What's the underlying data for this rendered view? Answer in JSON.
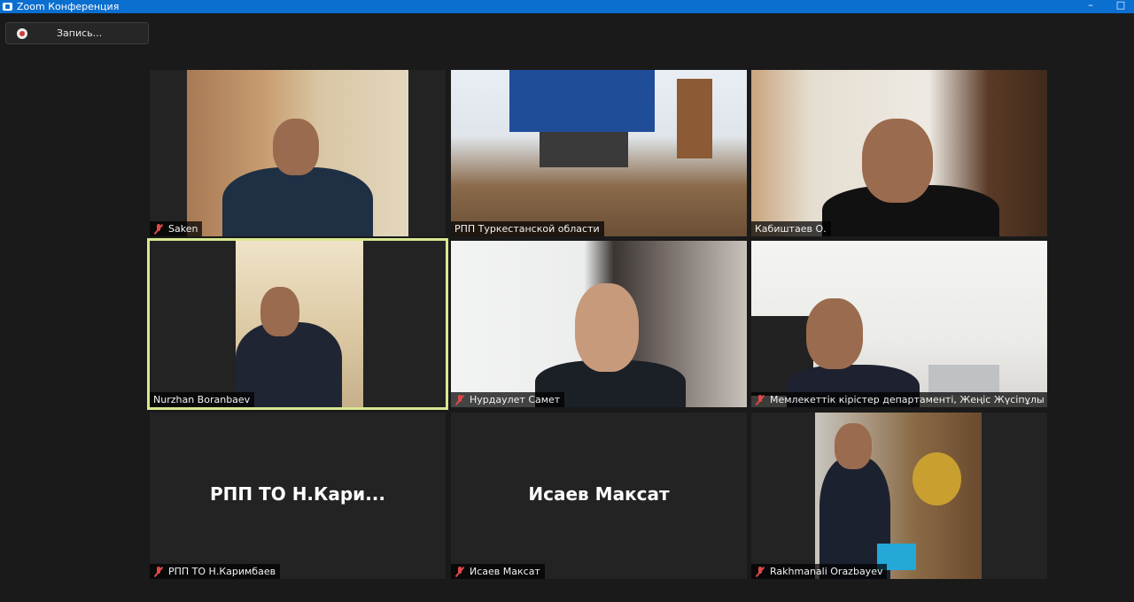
{
  "window": {
    "title": "Zoom Конференция"
  },
  "recording": {
    "label": "Запись..."
  },
  "participants": [
    {
      "name": "Saken",
      "muted": true
    },
    {
      "name": "РПП Туркестанской области",
      "muted": false
    },
    {
      "name": "Кабиштаев О.",
      "muted": false
    },
    {
      "name": "Nurzhan Boranbaev",
      "muted": false,
      "active_speaker": true
    },
    {
      "name": "Нурдаулет Самет",
      "muted": true
    },
    {
      "name": "Мемлекеттік кірістер департаменті, Жеңіс Жүсіпұлы",
      "muted": true
    },
    {
      "name": "РПП ТО Н.Каримбаев",
      "display": "РПП ТО Н.Кари...",
      "muted": true,
      "video_off": true
    },
    {
      "name": "Исаев Максат",
      "display": "Исаев Максат",
      "muted": true,
      "video_off": true
    },
    {
      "name": "Rakhmanali Orazbayev",
      "muted": true
    }
  ],
  "colors": {
    "titlebar": "#0b6fd0",
    "active_border": "#d8e890",
    "muted_icon": "#e04848"
  }
}
